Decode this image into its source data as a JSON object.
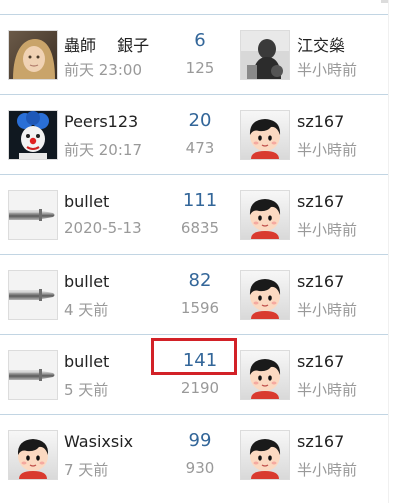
{
  "threads": [
    {
      "author": "蟲師　 銀子",
      "author_time": "前天 23:00",
      "author_avatar": "photo-child-avatar",
      "replies": "6",
      "views": "125",
      "last_poster": "江交燊",
      "last_time": "半小時前",
      "last_avatar": "photo-dark-avatar"
    },
    {
      "author": "Peers123",
      "author_time": "前天 20:17",
      "author_avatar": "photo-clown-avatar",
      "replies": "20",
      "views": "473",
      "last_poster": "sz167",
      "last_time": "半小時前",
      "last_avatar": "default-cartoon-avatar"
    },
    {
      "author": "bullet",
      "author_time": "2020-5-13",
      "author_avatar": "bullet-avatar",
      "replies": "111",
      "views": "6835",
      "last_poster": "sz167",
      "last_time": "半小時前",
      "last_avatar": "default-cartoon-avatar"
    },
    {
      "author": "bullet",
      "author_time": "4 天前",
      "author_avatar": "bullet-avatar",
      "replies": "82",
      "views": "1596",
      "last_poster": "sz167",
      "last_time": "半小時前",
      "last_avatar": "default-cartoon-avatar"
    },
    {
      "author": "bullet",
      "author_time": "5 天前",
      "author_avatar": "bullet-avatar",
      "replies": "141",
      "views": "2190",
      "last_poster": "sz167",
      "last_time": "半小時前",
      "last_avatar": "default-cartoon-avatar",
      "highlighted": true
    },
    {
      "author": "Wasixsix",
      "author_time": "7 天前",
      "author_avatar": "default-cartoon-avatar",
      "replies": "99",
      "views": "930",
      "last_poster": "sz167",
      "last_time": "半小時前",
      "last_avatar": "default-cartoon-avatar"
    }
  ],
  "colors": {
    "replies": "#336699",
    "muted": "#999999",
    "divider": "#c2d5e3",
    "highlight": "#d22127"
  }
}
